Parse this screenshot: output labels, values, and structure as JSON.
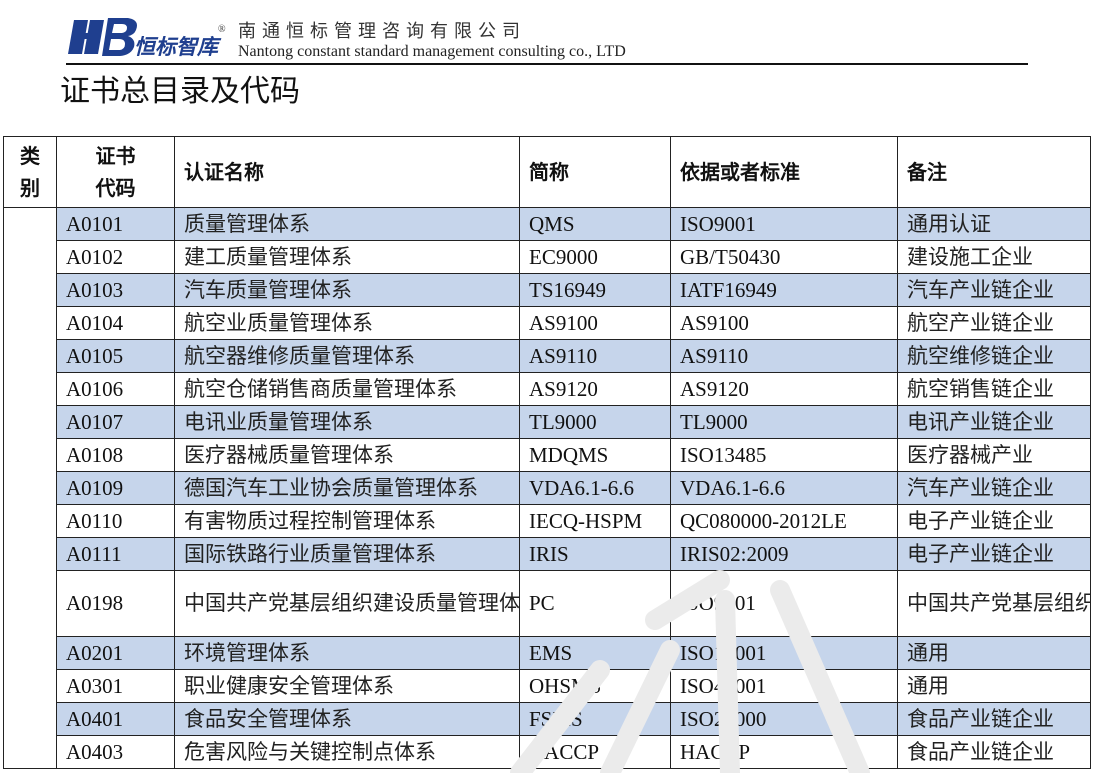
{
  "header": {
    "logo_text": "HB恒标智库",
    "company_cn": "南通恒标管理咨询有限公司",
    "company_en": "Nantong constant standard management consulting co., LTD",
    "reg_mark": "®"
  },
  "doc_title": "证书总目录及代码",
  "colors": {
    "row_highlight": "#c6d5eb",
    "logo_blue": "#1f3f8f"
  },
  "table": {
    "headers": {
      "category_line1": "类",
      "category_line2": "别",
      "code_line1": "证书",
      "code_line2": "代码",
      "name": "认证名称",
      "abbr": "简称",
      "standard": "依据或者标准",
      "note": "备注"
    },
    "rows": [
      {
        "code": "A0101",
        "name": "质量管理体系",
        "abbr": "QMS",
        "standard": "ISO9001",
        "note": "通用认证"
      },
      {
        "code": "A0102",
        "name": "建工质量管理体系",
        "abbr": "EC9000",
        "standard": "GB/T50430",
        "note": "建设施工企业"
      },
      {
        "code": "A0103",
        "name": "汽车质量管理体系",
        "abbr": "TS16949",
        "standard": "IATF16949",
        "note": "汽车产业链企业"
      },
      {
        "code": "A0104",
        "name": "航空业质量管理体系",
        "abbr": "AS9100",
        "standard": "AS9100",
        "note": "航空产业链企业"
      },
      {
        "code": "A0105",
        "name": "航空器维修质量管理体系",
        "abbr": "AS9110",
        "standard": "AS9110",
        "note": "航空维修链企业"
      },
      {
        "code": "A0106",
        "name": "航空仓储销售商质量管理体系",
        "abbr": "AS9120",
        "standard": "AS9120",
        "note": "航空销售链企业"
      },
      {
        "code": "A0107",
        "name": "电讯业质量管理体系",
        "abbr": "TL9000",
        "standard": "TL9000",
        "note": "电讯产业链企业"
      },
      {
        "code": "A0108",
        "name": "医疗器械质量管理体系",
        "abbr": "MDQMS",
        "standard": "ISO13485",
        "note": "医疗器械产业"
      },
      {
        "code": "A0109",
        "name": "德国汽车工业协会质量管理体系",
        "abbr": "VDA6.1-6.6",
        "standard": "VDA6.1-6.6",
        "note": "汽车产业链企业"
      },
      {
        "code": "A0110",
        "name": "有害物质过程控制管理体系",
        "abbr": "IECQ-HSPM",
        "standard": "QC080000-2012LE",
        "note": "电子产业链企业"
      },
      {
        "code": "A0111",
        "name": "国际铁路行业质量管理体系",
        "abbr": "IRIS",
        "standard": "IRIS02:2009",
        "note": "电子产业链企业"
      },
      {
        "code": "A0198",
        "name": "中国共产党基层组织建设质量管理体系",
        "abbr": "PC",
        "standard": "ISO9001",
        "note": "中国共产党基层组织"
      },
      {
        "code": "A0201",
        "name": "环境管理体系",
        "abbr": "EMS",
        "standard": "ISO14001",
        "note": "通用"
      },
      {
        "code": "A0301",
        "name": "职业健康安全管理体系",
        "abbr": "OHSMS",
        "standard": "ISO45001",
        "note": "通用"
      },
      {
        "code": "A0401",
        "name": "食品安全管理体系",
        "abbr": "FSMS",
        "standard": "ISO22000",
        "note": "食品产业链企业"
      },
      {
        "code": "A0403",
        "name": "危害风险与关键控制点体系",
        "abbr": "HACCP",
        "standard": "HACCP",
        "note": "食品产业链企业"
      }
    ]
  }
}
